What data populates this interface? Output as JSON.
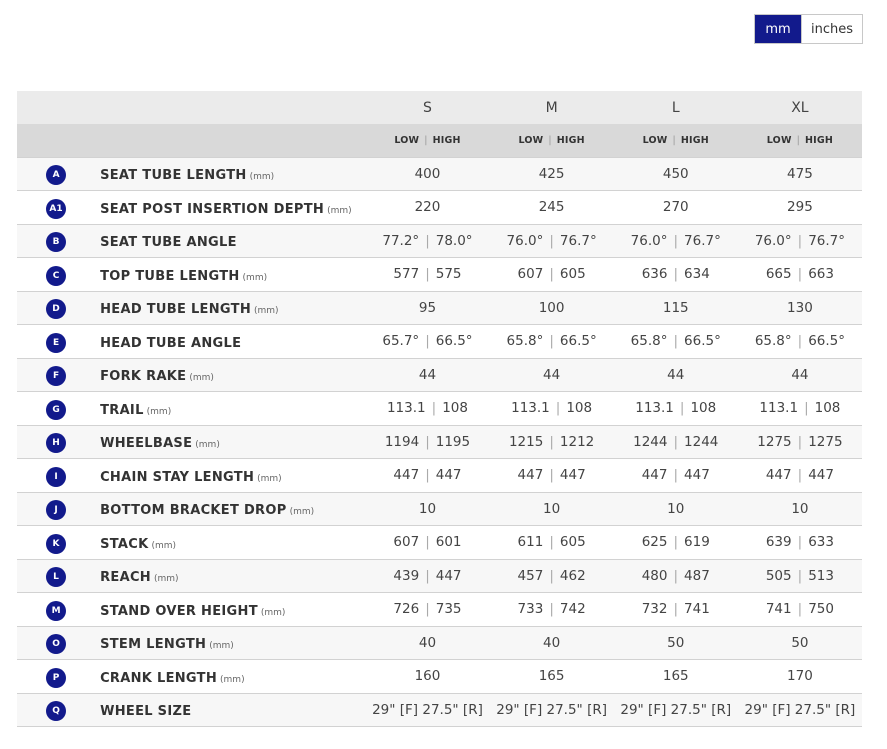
{
  "units": {
    "active": "mm",
    "inactive": "inches"
  },
  "sizes": [
    "S",
    "M",
    "L",
    "XL"
  ],
  "sub_header": {
    "low": "LOW",
    "high": "HIGH",
    "sep": "|"
  },
  "rows": [
    {
      "badge": "A",
      "label": "SEAT TUBE LENGTH",
      "unit": "(mm)",
      "values": [
        [
          "400"
        ],
        [
          "425"
        ],
        [
          "450"
        ],
        [
          "475"
        ]
      ]
    },
    {
      "badge": "A1",
      "label": "SEAT POST INSERTION DEPTH",
      "unit": "(mm)",
      "values": [
        [
          "220"
        ],
        [
          "245"
        ],
        [
          "270"
        ],
        [
          "295"
        ]
      ]
    },
    {
      "badge": "B",
      "label": "SEAT TUBE ANGLE",
      "unit": "",
      "values": [
        [
          "77.2°",
          "78.0°"
        ],
        [
          "76.0°",
          "76.7°"
        ],
        [
          "76.0°",
          "76.7°"
        ],
        [
          "76.0°",
          "76.7°"
        ]
      ]
    },
    {
      "badge": "C",
      "label": "TOP TUBE LENGTH",
      "unit": "(mm)",
      "values": [
        [
          "577",
          "575"
        ],
        [
          "607",
          "605"
        ],
        [
          "636",
          "634"
        ],
        [
          "665",
          "663"
        ]
      ]
    },
    {
      "badge": "D",
      "label": "HEAD TUBE LENGTH",
      "unit": "(mm)",
      "values": [
        [
          "95"
        ],
        [
          "100"
        ],
        [
          "115"
        ],
        [
          "130"
        ]
      ]
    },
    {
      "badge": "E",
      "label": "HEAD TUBE ANGLE",
      "unit": "",
      "values": [
        [
          "65.7°",
          "66.5°"
        ],
        [
          "65.8°",
          "66.5°"
        ],
        [
          "65.8°",
          "66.5°"
        ],
        [
          "65.8°",
          "66.5°"
        ]
      ]
    },
    {
      "badge": "F",
      "label": "FORK RAKE",
      "unit": "(mm)",
      "values": [
        [
          "44"
        ],
        [
          "44"
        ],
        [
          "44"
        ],
        [
          "44"
        ]
      ]
    },
    {
      "badge": "G",
      "label": "TRAIL",
      "unit": "(mm)",
      "values": [
        [
          "113.1",
          "108"
        ],
        [
          "113.1",
          "108"
        ],
        [
          "113.1",
          "108"
        ],
        [
          "113.1",
          "108"
        ]
      ]
    },
    {
      "badge": "H",
      "label": "WHEELBASE",
      "unit": "(mm)",
      "values": [
        [
          "1194",
          "1195"
        ],
        [
          "1215",
          "1212"
        ],
        [
          "1244",
          "1244"
        ],
        [
          "1275",
          "1275"
        ]
      ]
    },
    {
      "badge": "I",
      "label": "CHAIN STAY LENGTH",
      "unit": "(mm)",
      "values": [
        [
          "447",
          "447"
        ],
        [
          "447",
          "447"
        ],
        [
          "447",
          "447"
        ],
        [
          "447",
          "447"
        ]
      ]
    },
    {
      "badge": "J",
      "label": "BOTTOM BRACKET DROP",
      "unit": "(mm)",
      "values": [
        [
          "10"
        ],
        [
          "10"
        ],
        [
          "10"
        ],
        [
          "10"
        ]
      ]
    },
    {
      "badge": "K",
      "label": "STACK",
      "unit": "(mm)",
      "values": [
        [
          "607",
          "601"
        ],
        [
          "611",
          "605"
        ],
        [
          "625",
          "619"
        ],
        [
          "639",
          "633"
        ]
      ]
    },
    {
      "badge": "L",
      "label": "REACH",
      "unit": "(mm)",
      "values": [
        [
          "439",
          "447"
        ],
        [
          "457",
          "462"
        ],
        [
          "480",
          "487"
        ],
        [
          "505",
          "513"
        ]
      ]
    },
    {
      "badge": "M",
      "label": "STAND OVER HEIGHT",
      "unit": "(mm)",
      "values": [
        [
          "726",
          "735"
        ],
        [
          "733",
          "742"
        ],
        [
          "732",
          "741"
        ],
        [
          "741",
          "750"
        ]
      ]
    },
    {
      "badge": "O",
      "label": "STEM LENGTH",
      "unit": "(mm)",
      "values": [
        [
          "40"
        ],
        [
          "40"
        ],
        [
          "50"
        ],
        [
          "50"
        ]
      ]
    },
    {
      "badge": "P",
      "label": "CRANK LENGTH",
      "unit": "(mm)",
      "values": [
        [
          "160"
        ],
        [
          "165"
        ],
        [
          "165"
        ],
        [
          "170"
        ]
      ]
    },
    {
      "badge": "Q",
      "label": "WHEEL SIZE",
      "unit": "",
      "values": [
        [
          "29\" [F] 27.5\" [R]"
        ],
        [
          "29\" [F] 27.5\" [R]"
        ],
        [
          "29\" [F] 27.5\" [R]"
        ],
        [
          "29\" [F] 27.5\" [R]"
        ]
      ]
    }
  ],
  "colors": {
    "accent": "#121a8c",
    "header_bg": "#ebebeb",
    "subheader_bg": "#d9d9d9"
  }
}
